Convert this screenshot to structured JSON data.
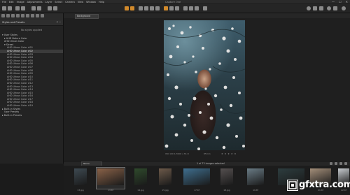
{
  "window": {
    "title": "Capture One",
    "menu": [
      "File",
      "Edit",
      "Image",
      "Adjustments",
      "Layer",
      "Select",
      "Camera",
      "View",
      "Window",
      "Help"
    ],
    "controls": [
      "—",
      "☐",
      "✕"
    ]
  },
  "viewer": {
    "background_select": "Background",
    "photo_info": {
      "left": "ISO 100   1/3200 s   f/1.8",
      "middle": "85mm",
      "stars": "★ ★ ★ ★ ★"
    }
  },
  "left_panel": {
    "header": "Styles and Presets",
    "no_styles": "No styles applied",
    "tree": [
      {
        "label": "▾ User Styles",
        "level": 0
      },
      {
        "label": "▸ AHD Nature Color",
        "level": 1
      },
      {
        "label": "AHD Urban Color",
        "level": 1
      },
      {
        "label": "▾ Street",
        "level": 1
      },
      {
        "label": "AHD Urban Color #01",
        "level": 2
      },
      {
        "label": "AHD Urban Color #02",
        "level": 2,
        "selected": true
      },
      {
        "label": "AHD Urban Color #03",
        "level": 2
      },
      {
        "label": "AHD Urban Color #04",
        "level": 2
      },
      {
        "label": "AHD Urban Color #05",
        "level": 2
      },
      {
        "label": "AHD Urban Color #06",
        "level": 2
      },
      {
        "label": "AHD Urban Color #07",
        "level": 2
      },
      {
        "label": "AHD Urban Color #08",
        "level": 2
      },
      {
        "label": "AHD Urban Color #09",
        "level": 2
      },
      {
        "label": "AHD Urban Color #10",
        "level": 2
      },
      {
        "label": "AHD Urban Color #11",
        "level": 2
      },
      {
        "label": "AHD Urban Color #12",
        "level": 2
      },
      {
        "label": "AHD Urban Color #13",
        "level": 2
      },
      {
        "label": "AHD Urban Color #14",
        "level": 2
      },
      {
        "label": "AHD Urban Color #15",
        "level": 2
      },
      {
        "label": "AHD Urban Color #16",
        "level": 2
      },
      {
        "label": "AHD Urban Color #17",
        "level": 2
      },
      {
        "label": "AHD Urban Color #18",
        "level": 2
      },
      {
        "label": "AHD Urban Color #19",
        "level": 2
      },
      {
        "label": "▸ Built-in Styles",
        "level": 0
      },
      {
        "label": "User Presets",
        "level": 1
      },
      {
        "label": "▸ Built-in Presets",
        "level": 0
      }
    ]
  },
  "browser": {
    "sort": "Name",
    "count": "1 of 73 images selected",
    "thumbnails": [
      {
        "caption": "13.jpg",
        "color": "#3e4a52"
      },
      {
        "caption": "13.tif",
        "color": "#8a6248"
      },
      {
        "caption": "14.jpg",
        "color": "#2f4a2c"
      },
      {
        "caption": "15.jpg",
        "color": "#6d5a4a"
      },
      {
        "caption": "17.tif",
        "color": "#3f6f8f"
      },
      {
        "caption": "18.jpg",
        "color": "#555050"
      },
      {
        "caption": "19.tif",
        "color": "#6a7c86"
      },
      {
        "caption": "20.tif",
        "color": "#2d3d3f"
      },
      {
        "caption": "21.tif",
        "color": "#a48f7a"
      },
      {
        "caption": "22.tif",
        "color": "#c7cbcf"
      },
      {
        "caption": "23.tif",
        "color": "#5a5f62"
      }
    ]
  },
  "watermark": {
    "text": "gfxtra.com"
  }
}
